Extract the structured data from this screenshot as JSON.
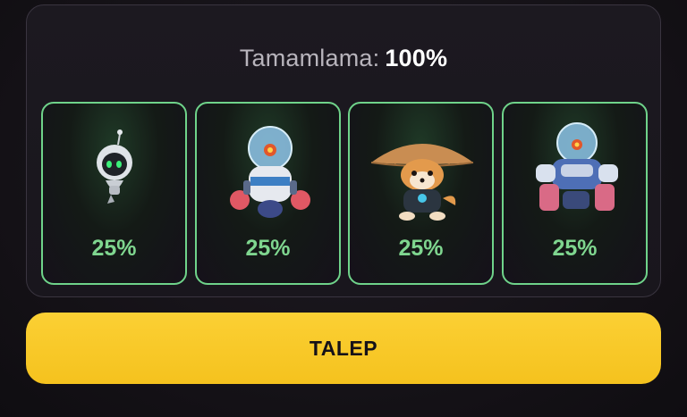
{
  "completion": {
    "label": "Tamamlama:",
    "value": "100%"
  },
  "cards": [
    {
      "icon": "small-robot-icon",
      "percent": "25%"
    },
    {
      "icon": "fishbowl-robot-boxer-icon",
      "percent": "25%"
    },
    {
      "icon": "shiba-straw-hat-icon",
      "percent": "25%"
    },
    {
      "icon": "armored-robot-boxer-icon",
      "percent": "25%"
    }
  ],
  "claim_button": {
    "label": "TALEP"
  },
  "colors": {
    "accent_green": "#6fd38a",
    "button_yellow": "#f9c926",
    "background": "#17141a"
  }
}
